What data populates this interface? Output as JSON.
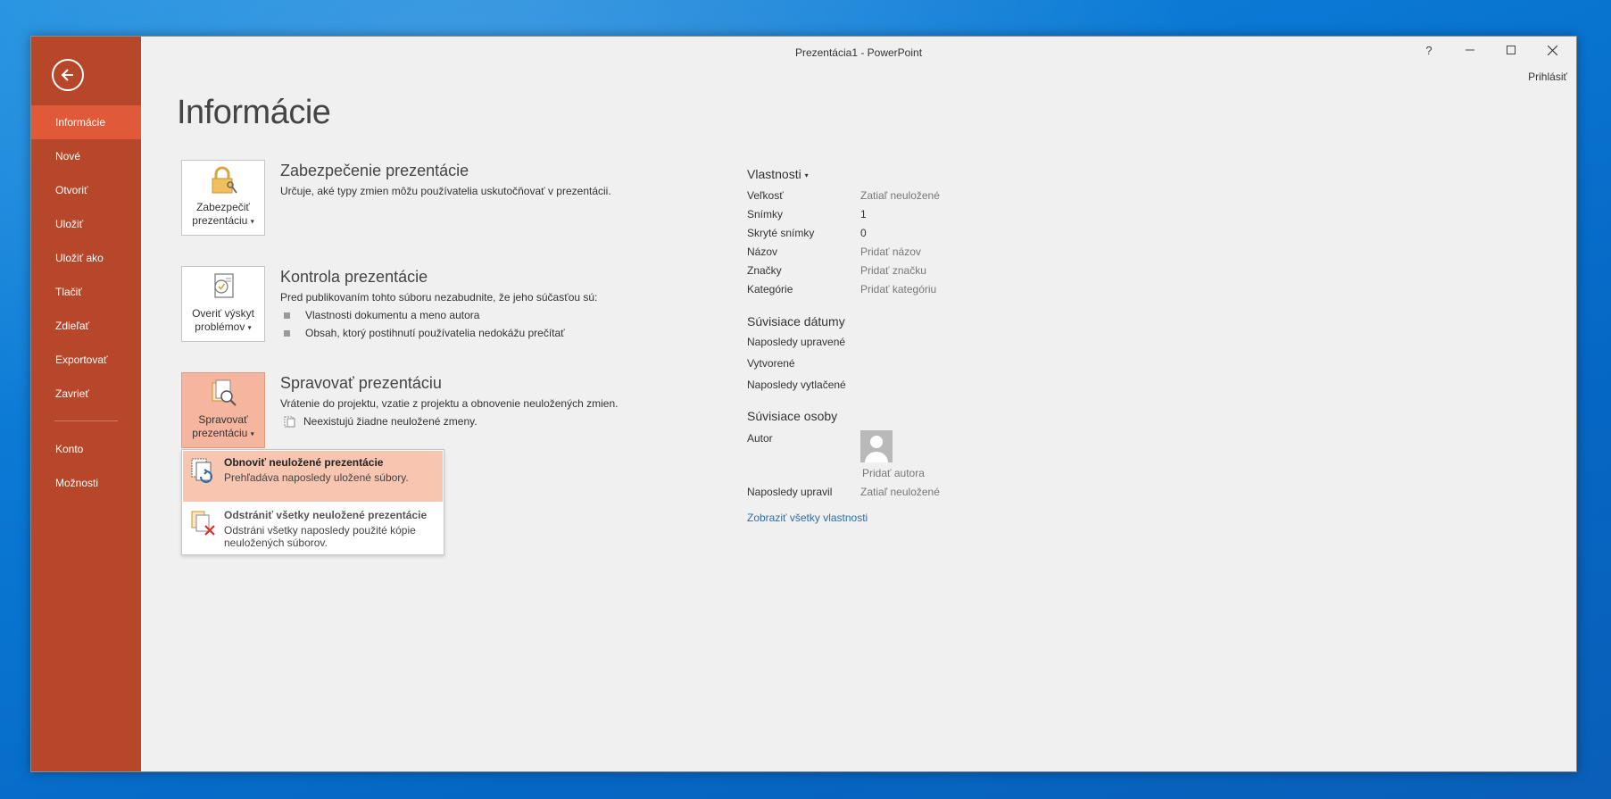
{
  "window": {
    "title": "Prezentácia1 - PowerPoint",
    "help": "?",
    "signin": "Prihlásiť"
  },
  "sidebar": {
    "items": [
      {
        "label": "Informácie",
        "active": true
      },
      {
        "label": "Nové"
      },
      {
        "label": "Otvoriť"
      },
      {
        "label": "Uložiť"
      },
      {
        "label": "Uložiť ako"
      },
      {
        "label": "Tlačiť"
      },
      {
        "label": "Zdieľať"
      },
      {
        "label": "Exportovať"
      },
      {
        "label": "Zavrieť"
      }
    ],
    "bottom_items": [
      {
        "label": "Konto"
      },
      {
        "label": "Možnosti"
      }
    ]
  },
  "page": {
    "title": "Informácie"
  },
  "protect": {
    "button_line1": "Zabezpečiť",
    "button_line2": "prezentáciu",
    "title": "Zabezpečenie prezentácie",
    "desc": "Určuje, aké typy zmien môžu používatelia uskutočňovať v prezentácii."
  },
  "inspect": {
    "button_line1": "Overiť výskyt",
    "button_line2": "problémov",
    "title": "Kontrola prezentácie",
    "desc": "Pred publikovaním tohto súboru nezabudnite, že jeho súčasťou sú:",
    "bullets": [
      "Vlastnosti dokumentu a meno autora",
      "Obsah, ktorý postihnutí používatelia nedokážu prečítať"
    ]
  },
  "manage": {
    "button_line1": "Spravovať",
    "button_line2": "prezentáciu",
    "title": "Spravovať prezentáciu",
    "desc": "Vrátenie do projektu, vzatie z projektu a obnovenie neuložených zmien.",
    "status": "Neexistujú žiadne neuložené zmeny."
  },
  "dropdown": {
    "items": [
      {
        "title": "Obnoviť neuložené prezentácie",
        "desc": "Prehľadáva naposledy uložené súbory."
      },
      {
        "title": "Odstrániť všetky neuložené prezentácie",
        "desc_line1": "Odstráni všetky naposledy použité kópie",
        "desc_line2": "neuložených súborov."
      }
    ]
  },
  "properties": {
    "head": "Vlastnosti",
    "rows": [
      {
        "key": "Veľkosť",
        "value": "Zatiaľ neuložené"
      },
      {
        "key": "Snímky",
        "value": "1"
      },
      {
        "key": "Skryté snímky",
        "value": "0"
      },
      {
        "key": "Názov",
        "value": "Pridať názov"
      },
      {
        "key": "Značky",
        "value": "Pridať značku"
      },
      {
        "key": "Kategórie",
        "value": "Pridať kategóriu"
      }
    ],
    "dates_head": "Súvisiace dátumy",
    "dates": [
      "Naposledy upravené",
      "Vytvorené",
      "Naposledy vytlačené"
    ],
    "people_head": "Súvisiace osoby",
    "author_key": "Autor",
    "add_author": "Pridať autora",
    "last_modified_by_key": "Naposledy upravil",
    "last_modified_by_value": "Zatiaľ neuložené",
    "show_all": "Zobraziť všetky vlastnosti"
  }
}
